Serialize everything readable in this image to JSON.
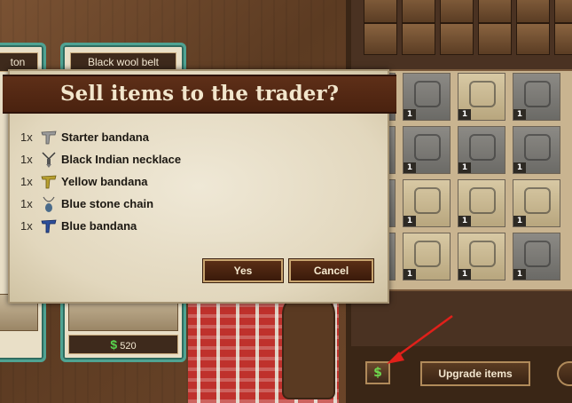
{
  "store": {
    "left_card_title": "ton",
    "right_card_title": "Black wool belt",
    "right_card_price": "520",
    "currency_symbol": "$"
  },
  "dialog": {
    "title": "Sell items to the trader?",
    "items": [
      {
        "qty": "1x",
        "name": "Starter bandana",
        "icon": "starter-bandana-icon",
        "color": "#9a9a9a"
      },
      {
        "qty": "1x",
        "name": "Black Indian necklace",
        "icon": "black-indian-necklace-icon",
        "color": "#3a3a3a"
      },
      {
        "qty": "1x",
        "name": "Yellow bandana",
        "icon": "yellow-bandana-icon",
        "color": "#b8a030"
      },
      {
        "qty": "1x",
        "name": "Blue stone chain",
        "icon": "blue-stone-chain-icon",
        "color": "#4a6b8a"
      },
      {
        "qty": "1x",
        "name": "Blue bandana",
        "icon": "blue-bandana-icon",
        "color": "#2d4f9a"
      }
    ],
    "yes_label": "Yes",
    "cancel_label": "Cancel"
  },
  "inventory": {
    "slot_count_label": "1",
    "sell_label": "$",
    "upgrade_label": "Upgrade items"
  },
  "colors": {
    "accent_teal": "#4fa392",
    "dialog_header": "#5e2f18",
    "arrow": "#e0201a",
    "money_green": "#58d44e"
  }
}
